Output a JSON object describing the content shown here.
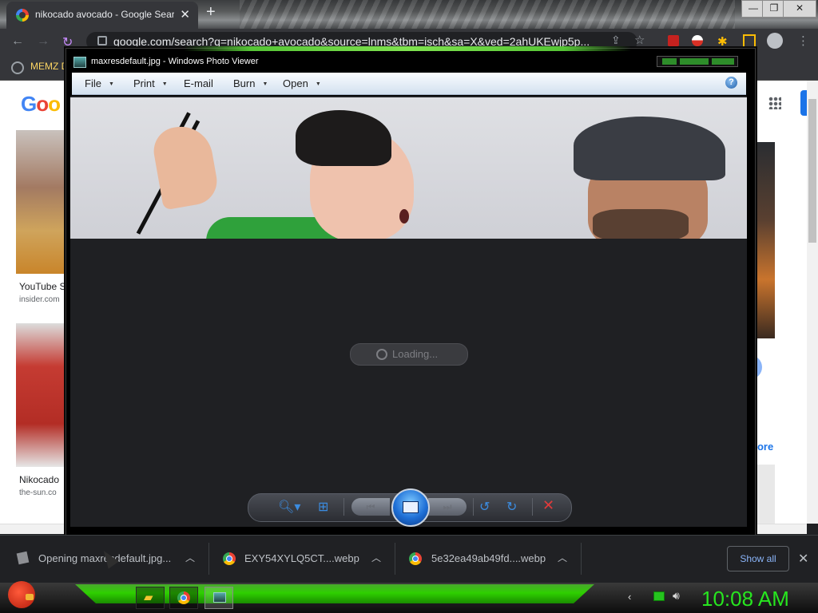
{
  "chrome": {
    "tab_title": "nikocado avocado - Google Search",
    "tab_close": "✕",
    "new_tab": "+",
    "window_min": "—",
    "window_max": "❐",
    "window_close": "✕",
    "url": "google.com/search?q=nikocado+avocado&source=lnms&tbm=isch&sa=X&ved=2ahUKEwjp5p...",
    "bookmark_label": "MEMZ D"
  },
  "google_page": {
    "logo_text": "Goo",
    "results": [
      {
        "caption": "YouTube S",
        "source": "insider.com"
      },
      {
        "caption": "Nikocado",
        "source": "the-sun.co"
      }
    ],
    "more_label": "nore"
  },
  "photo_viewer": {
    "title": "maxresdefault.jpg - Windows Photo Viewer",
    "menu": {
      "file": "File",
      "print": "Print",
      "email": "E-mail",
      "burn": "Burn",
      "open": "Open"
    },
    "help": "?",
    "loading_text": "Loading...",
    "controls": {
      "zoom": "zoom-icon",
      "fit": "actual-size-icon",
      "prev": "previous-icon",
      "slideshow": "slideshow-icon",
      "next": "next-icon",
      "rotate_ccw": "rotate-counterclockwise-icon",
      "rotate_cw": "rotate-clockwise-icon",
      "delete": "delete-icon"
    }
  },
  "downloads": {
    "items": [
      {
        "name": "Opening maxresdefault.jpg..."
      },
      {
        "name": "EXY54XYLQ5CT....webp"
      },
      {
        "name": "5e32ea49ab49fd....webp"
      }
    ],
    "show_all": "Show all",
    "close": "✕"
  },
  "taskbar": {
    "clock": "10:08 AM"
  }
}
